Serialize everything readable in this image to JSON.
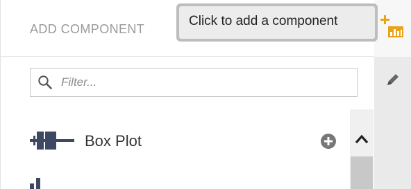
{
  "panel": {
    "title": "ADD COMPONENT",
    "header_extra": ", ,"
  },
  "filter": {
    "placeholder": "Filter...",
    "value": ""
  },
  "list": {
    "items": [
      {
        "label": "Box Plot",
        "icon": "box-plot-icon"
      }
    ],
    "next_item_icon": "bar-chart-icon"
  },
  "toolbar": {
    "add_icon": "add-chart-icon",
    "edit_icon": "pencil-icon"
  },
  "tooltip": {
    "text": "Click to add a component"
  },
  "colors": {
    "accent": "#e8a317",
    "icon_dark": "#3d4863",
    "add_circle": "#777777"
  }
}
